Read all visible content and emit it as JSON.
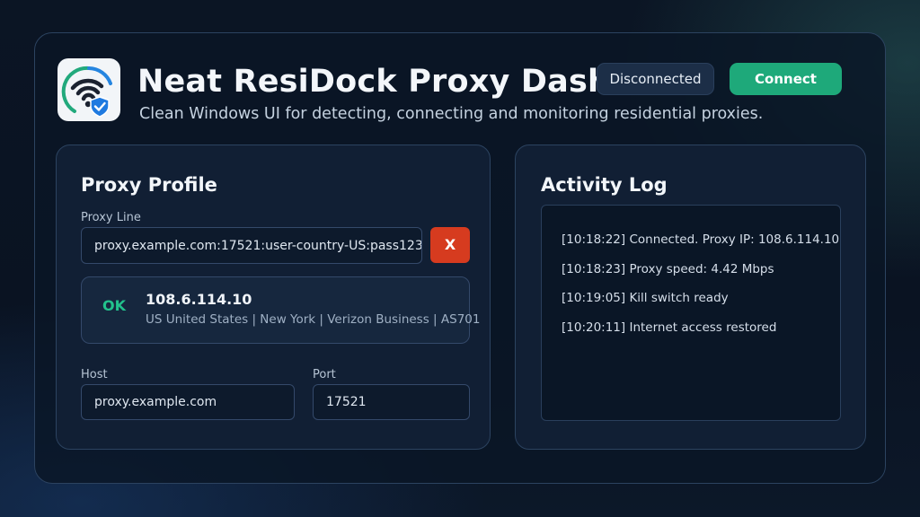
{
  "header": {
    "title": "Neat ResiDock Proxy Dashboard",
    "subtitle": "Clean Windows UI for detecting, connecting and monitoring residential proxies.",
    "status": "Disconnected",
    "connect_label": "Connect",
    "icon": "wifi-shield-icon"
  },
  "profile": {
    "title": "Proxy Profile",
    "proxy_line_label": "Proxy Line",
    "proxy_line_value": "proxy.example.com:17521:user-country-US:pass123",
    "clear_label": "X",
    "result": {
      "status": "OK",
      "ip": "108.6.114.10",
      "details": "US United States | New York | Verizon Business | AS701"
    },
    "host_label": "Host",
    "host_value": "proxy.example.com",
    "port_label": "Port",
    "port_value": "17521"
  },
  "log": {
    "title": "Activity Log",
    "entries": [
      "[10:18:22] Connected. Proxy IP: 108.6.114.10",
      "[10:18:23] Proxy speed: 4.42 Mbps",
      "[10:19:05] Kill switch ready",
      "[10:20:11] Internet access restored"
    ]
  },
  "colors": {
    "accent_green": "#1ea97a",
    "danger_red": "#d63b1f",
    "ok_green": "#22c28c",
    "shield_blue": "#1f7ae0"
  }
}
